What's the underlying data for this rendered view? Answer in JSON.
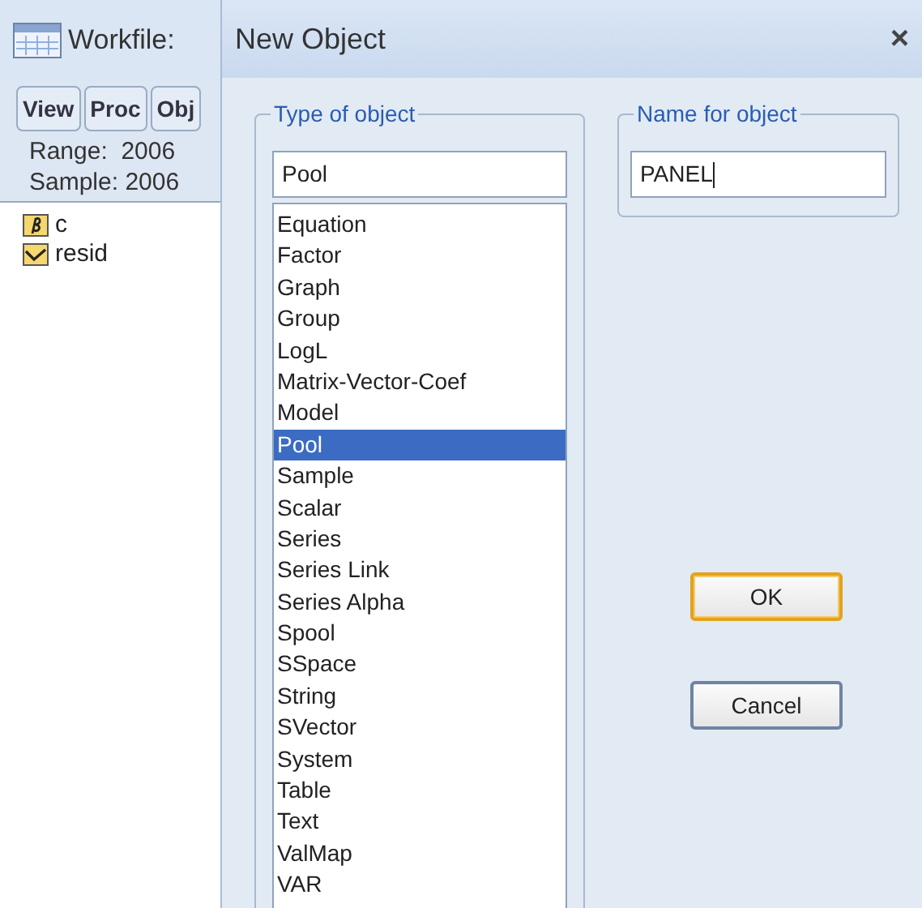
{
  "workfile": {
    "title": "Workfile:",
    "toolbar": [
      "View",
      "Proc",
      "Obj"
    ],
    "range": "Range:  2006",
    "sample": "Sample: 2006",
    "objects": [
      {
        "name": "c",
        "kind": "coef"
      },
      {
        "name": "resid",
        "kind": "series"
      }
    ]
  },
  "dialog": {
    "title": "New Object",
    "close": "×",
    "type_group": {
      "label": "Type of object",
      "value": "Pool",
      "items": [
        {
          "label": "Equation",
          "selected": false
        },
        {
          "label": "Factor",
          "selected": false
        },
        {
          "label": "Graph",
          "selected": false
        },
        {
          "label": "Group",
          "selected": false
        },
        {
          "label": "LogL",
          "selected": false
        },
        {
          "label": "Matrix-Vector-Coef",
          "selected": false
        },
        {
          "label": "Model",
          "selected": false
        },
        {
          "label": "Pool",
          "selected": true
        },
        {
          "label": "Sample",
          "selected": false
        },
        {
          "label": "Scalar",
          "selected": false
        },
        {
          "label": "Series",
          "selected": false
        },
        {
          "label": "Series Link",
          "selected": false
        },
        {
          "label": "Series Alpha",
          "selected": false
        },
        {
          "label": "Spool",
          "selected": false
        },
        {
          "label": "SSpace",
          "selected": false
        },
        {
          "label": "String",
          "selected": false
        },
        {
          "label": "SVector",
          "selected": false
        },
        {
          "label": "System",
          "selected": false
        },
        {
          "label": "Table",
          "selected": false
        },
        {
          "label": "Text",
          "selected": false
        },
        {
          "label": "ValMap",
          "selected": false
        },
        {
          "label": "VAR",
          "selected": false
        }
      ]
    },
    "name_group": {
      "label": "Name for object",
      "value": "PANEL"
    },
    "buttons": [
      {
        "label": "OK",
        "default": true
      },
      {
        "label": "Cancel",
        "default": false
      }
    ]
  }
}
